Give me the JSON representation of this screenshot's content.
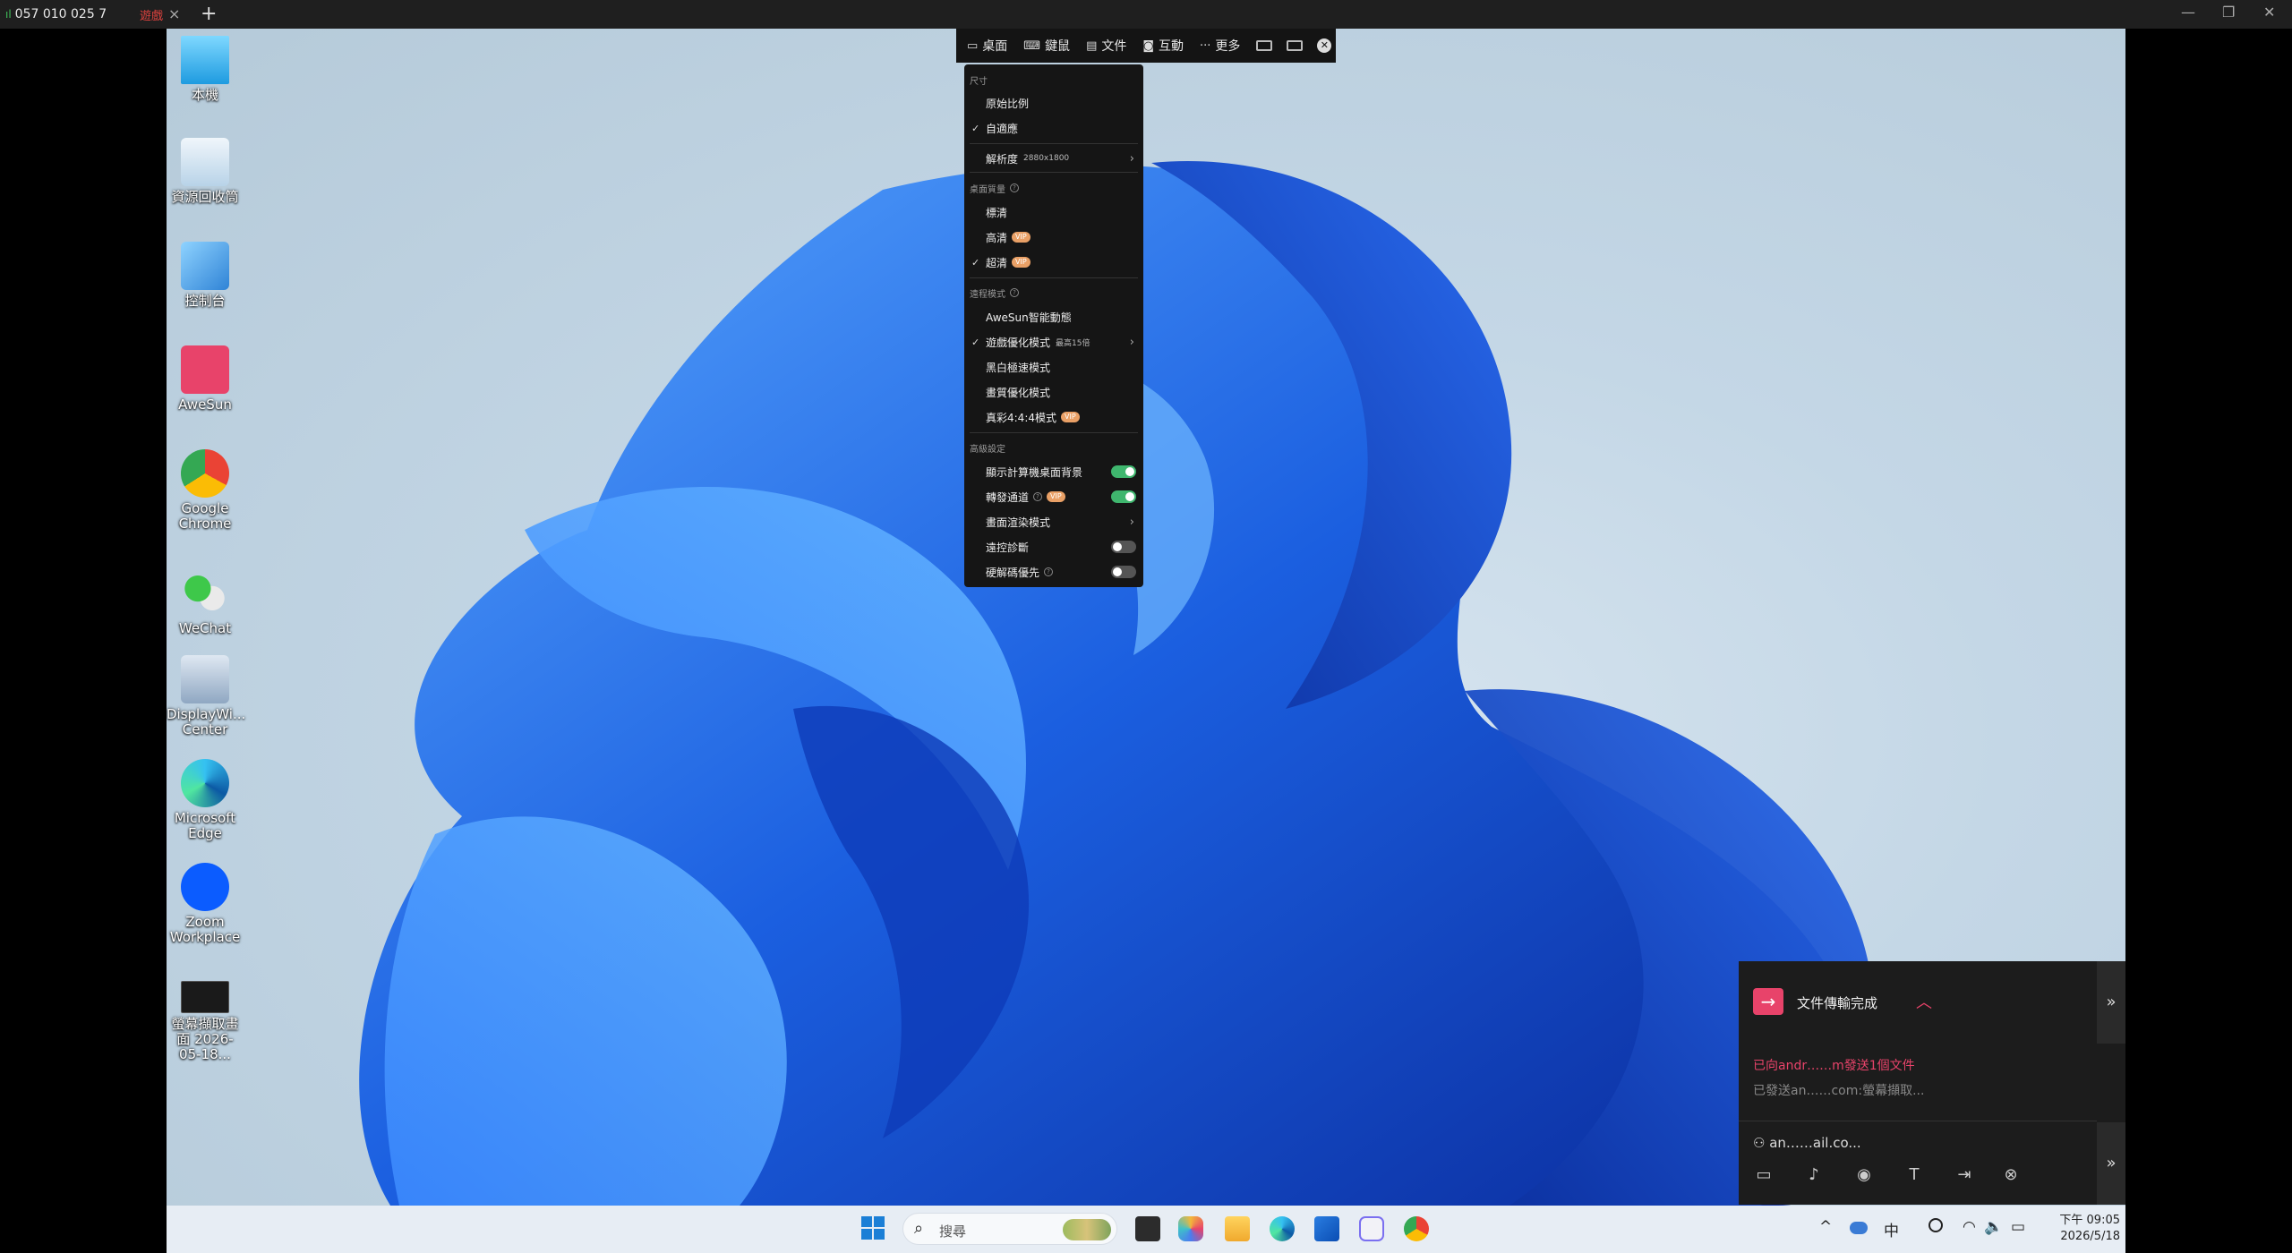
{
  "titlebar": {
    "tab1_signal": "ıl",
    "tab1_label": "057 010 025 7",
    "tab2_label": "遊戲",
    "tab_close": "×",
    "tab_add": "+",
    "minimize": "—",
    "restore": "❐",
    "close": "✕"
  },
  "desktop_icons": [
    {
      "label": "本機",
      "icon": "monitor-icon"
    },
    {
      "label": "資源回收筒",
      "icon": "recycle-bin-icon"
    },
    {
      "label": "控制台",
      "icon": "control-panel-icon"
    },
    {
      "label": "AweSun",
      "icon": "awesun-icon"
    },
    {
      "label": "Google Chrome",
      "icon": "chrome-icon"
    },
    {
      "label": "WeChat",
      "icon": "wechat-icon"
    },
    {
      "label": "DisplayWi... Center",
      "icon": "display-center-icon"
    },
    {
      "label": "Microsoft Edge",
      "icon": "edge-icon"
    },
    {
      "label": "Zoom Workplace",
      "icon": "zoom-icon"
    },
    {
      "label": "螢幕擷取畫面 2026-05-18...",
      "icon": "screenshot-file-icon"
    }
  ],
  "toolbar": {
    "desktop": "桌面",
    "keyboard": "鍵鼠",
    "file": "文件",
    "interact": "互動",
    "more_icon": "···",
    "more": "更多",
    "close": "✕"
  },
  "menu": {
    "size_header": "尺寸",
    "original_ratio": "原始比例",
    "fit": "自適應",
    "resolution": "解析度",
    "resolution_value": "2880x1800",
    "quality_header": "桌面質量",
    "standard": "標清",
    "high": "高清",
    "ultra": "超清",
    "vip": "VIP",
    "hint": "?",
    "mode_header": "遠程模式",
    "smart": "AweSun智能動態",
    "game": "遊戲優化模式",
    "game_detail": "最高15倍",
    "bw": "黑白極速模式",
    "image": "畫質優化模式",
    "true_color": "真彩4:4:4模式",
    "adv_header": "高級設定",
    "show_bg": "顯示計算機桌面背景",
    "relay": "轉發通道",
    "render": "畫面渲染模式",
    "diagnose": "遠控診斷",
    "hw_decode": "硬解碼優先",
    "check": "✓",
    "arrow": "›",
    "toggles": {
      "show_bg": true,
      "relay": true,
      "diagnose": false,
      "hw_decode": false
    }
  },
  "file_transfer": {
    "icon": "→",
    "title": "文件傳輸完成",
    "collapse": "︿",
    "expand": "»",
    "line1": "已向andr……m發送1個文件",
    "line2": "已發送an……com:螢幕擷取...",
    "user": "an……ail.co...",
    "tools": [
      "chat-icon",
      "mic-icon",
      "camera-icon",
      "text-icon",
      "file-send-icon",
      "close-circle-icon"
    ],
    "tool_glyphs": [
      "▭",
      "♪",
      "◉",
      "T",
      "⇥",
      "⊗"
    ]
  },
  "taskbar": {
    "search_icon": "⌕",
    "search_placeholder": "搜尋",
    "tray_chevron": "^",
    "ime": "中",
    "tray_wifi": "◠",
    "tray_sound": "🔈",
    "tray_battery": "▭",
    "time": "下午 09:05",
    "date": "2026/5/18"
  },
  "colors": {
    "accent_pink": "#e8436a",
    "toggle_on": "#3fb66e",
    "vip_badge": "#e9a066",
    "wallpaper_blue": "#1e5fd8"
  }
}
